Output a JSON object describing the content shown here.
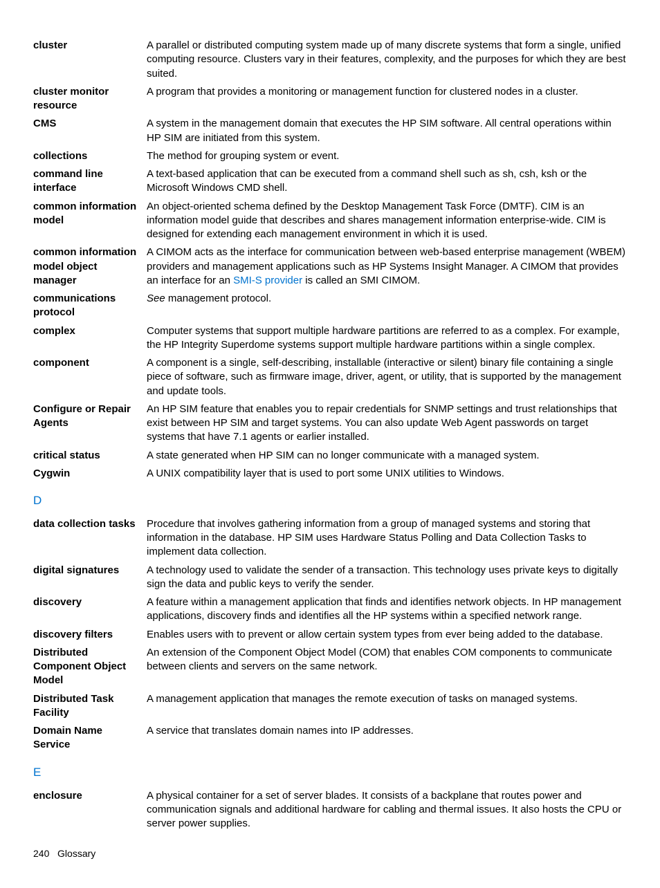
{
  "entries_c": [
    {
      "term": "cluster",
      "def": "A parallel or distributed computing system made up of many discrete systems that form a single, unified computing resource. Clusters vary in their features, complexity, and the purposes for which they are best suited."
    },
    {
      "term": "cluster monitor resource",
      "def": "A program that provides a monitoring or management function for clustered nodes in a cluster."
    },
    {
      "term": "CMS",
      "def": "A system in the management domain that executes the HP SIM software. All central operations within HP SIM are initiated from this system."
    },
    {
      "term": "collections",
      "def": "The method for grouping system or event."
    },
    {
      "term": "command line interface",
      "def": "A text-based application that can be executed from a command shell such as sh, csh, ksh or the Microsoft Windows CMD shell."
    },
    {
      "term": "common information model",
      "def": "An object-oriented schema defined by the Desktop Management Task Force (DMTF). CIM is an information model guide that describes and shares management information enterprise-wide. CIM is designed for extending each management environment in which it is used."
    },
    {
      "term": "common information model object manager",
      "def_parts": [
        "A CIMOM acts as the interface for communication between web-based enterprise management (WBEM) providers and management applications such as HP Systems Insight Manager. A CIMOM that provides an interface for an ",
        {
          "link": "SMI-S provider"
        },
        " is called an SMI CIMOM."
      ]
    },
    {
      "term": "communications protocol",
      "def_parts": [
        {
          "italic": "See"
        },
        " management protocol."
      ]
    },
    {
      "term": "complex",
      "def": "Computer systems that support multiple hardware partitions are referred to as a complex. For example, the HP Integrity Superdome systems support multiple hardware partitions within a single complex."
    },
    {
      "term": "component",
      "def": "A component is a single, self-describing, installable (interactive or silent) binary file containing a single piece of software, such as firmware image, driver, agent, or utility, that is supported by the management and update tools."
    },
    {
      "term": "Configure or Repair Agents",
      "def": "An HP SIM feature that enables you to repair credentials for SNMP settings and trust relationships that exist between HP SIM and target systems. You can also update Web Agent passwords on target systems that have 7.1 agents or earlier installed."
    },
    {
      "term": "critical status",
      "def": "A state generated when HP SIM can no longer communicate with a managed system."
    },
    {
      "term": "Cygwin",
      "def": "A UNIX compatibility layer that is used to port some UNIX utilities to Windows."
    }
  ],
  "section_d": "D",
  "entries_d": [
    {
      "term": "data collection tasks",
      "def": "Procedure that involves gathering information from a group of managed systems and storing that information in the database. HP SIM uses Hardware Status Polling and Data Collection Tasks to implement data collection."
    },
    {
      "term": "digital signatures",
      "def": "A technology used to validate the sender of a transaction. This technology uses private keys to digitally sign the data and public keys to verify the sender."
    },
    {
      "term": "discovery",
      "def": "A feature within a management application that finds and identifies network objects. In HP management applications, discovery finds and identifies all the HP systems within a specified network range."
    },
    {
      "term": "discovery filters",
      "def": "Enables users with to prevent or allow certain system types from ever being added to the database."
    },
    {
      "term": "Distributed Component Object Model",
      "def": "An extension of the Component Object Model (COM) that enables COM components to communicate between clients and servers on the same network."
    },
    {
      "term": "Distributed Task Facility",
      "def": "A management application that manages the remote execution of tasks on managed systems."
    },
    {
      "term": "Domain Name Service",
      "def": "A service that translates domain names into IP addresses."
    }
  ],
  "section_e": "E",
  "entries_e": [
    {
      "term": "enclosure",
      "def": "A physical container for a set of server blades. It consists of a backplane that routes power and communication signals and additional hardware for cabling and thermal issues. It also hosts the CPU or server power supplies."
    }
  ],
  "footer": {
    "page": "240",
    "title": "Glossary"
  }
}
